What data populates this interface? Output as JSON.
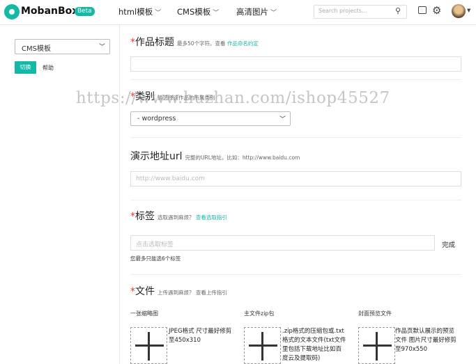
{
  "header": {
    "brand": "MobanBox",
    "badge": "Beta",
    "nav": [
      {
        "label": "html模板"
      },
      {
        "label": "CMS模板"
      },
      {
        "label": "高清图片"
      }
    ],
    "search_placeholder": "Search projects..."
  },
  "sidebar": {
    "category_value": "CMS模板",
    "switch_label": "切换",
    "help_label": "帮助"
  },
  "form": {
    "title": {
      "label": "作品标题",
      "hint": "最多50个字符。查看",
      "hint_link": "作品命名约定"
    },
    "category": {
      "label": "类别",
      "hint": "请选择该作品的所属类别",
      "value": "- wordpress"
    },
    "demo_url": {
      "label": "演示地址url",
      "hint": "完整的URL地址。比如：http://www.baidu.com",
      "placeholder": "http://www.baidu.com"
    },
    "tags": {
      "label": "标签",
      "hint": "选取遇到麻烦？",
      "hint_link": "查看选取指引",
      "placeholder": "点击选取标签",
      "done_label": "完成",
      "note": "您最多只能选6个标签"
    },
    "files": {
      "label": "文件",
      "hint": "上传遇到麻烦？ 查看上传指引",
      "columns": [
        {
          "title": "一张缩略图",
          "desc": "JPEG格式 尺寸最好修剪至450x310"
        },
        {
          "title": "主文件zip包",
          "desc": ".zip格式的压缩包或.txt格式的文本文件(txt文件里包括下载地址比如百度云及提取码)"
        },
        {
          "title": "封面预览文件",
          "desc": "作品页默认展示的预览文件 图片尺寸最好修剪至970x550"
        }
      ]
    }
  },
  "watermark": "https://www.huzhan.com/ishop45527"
}
